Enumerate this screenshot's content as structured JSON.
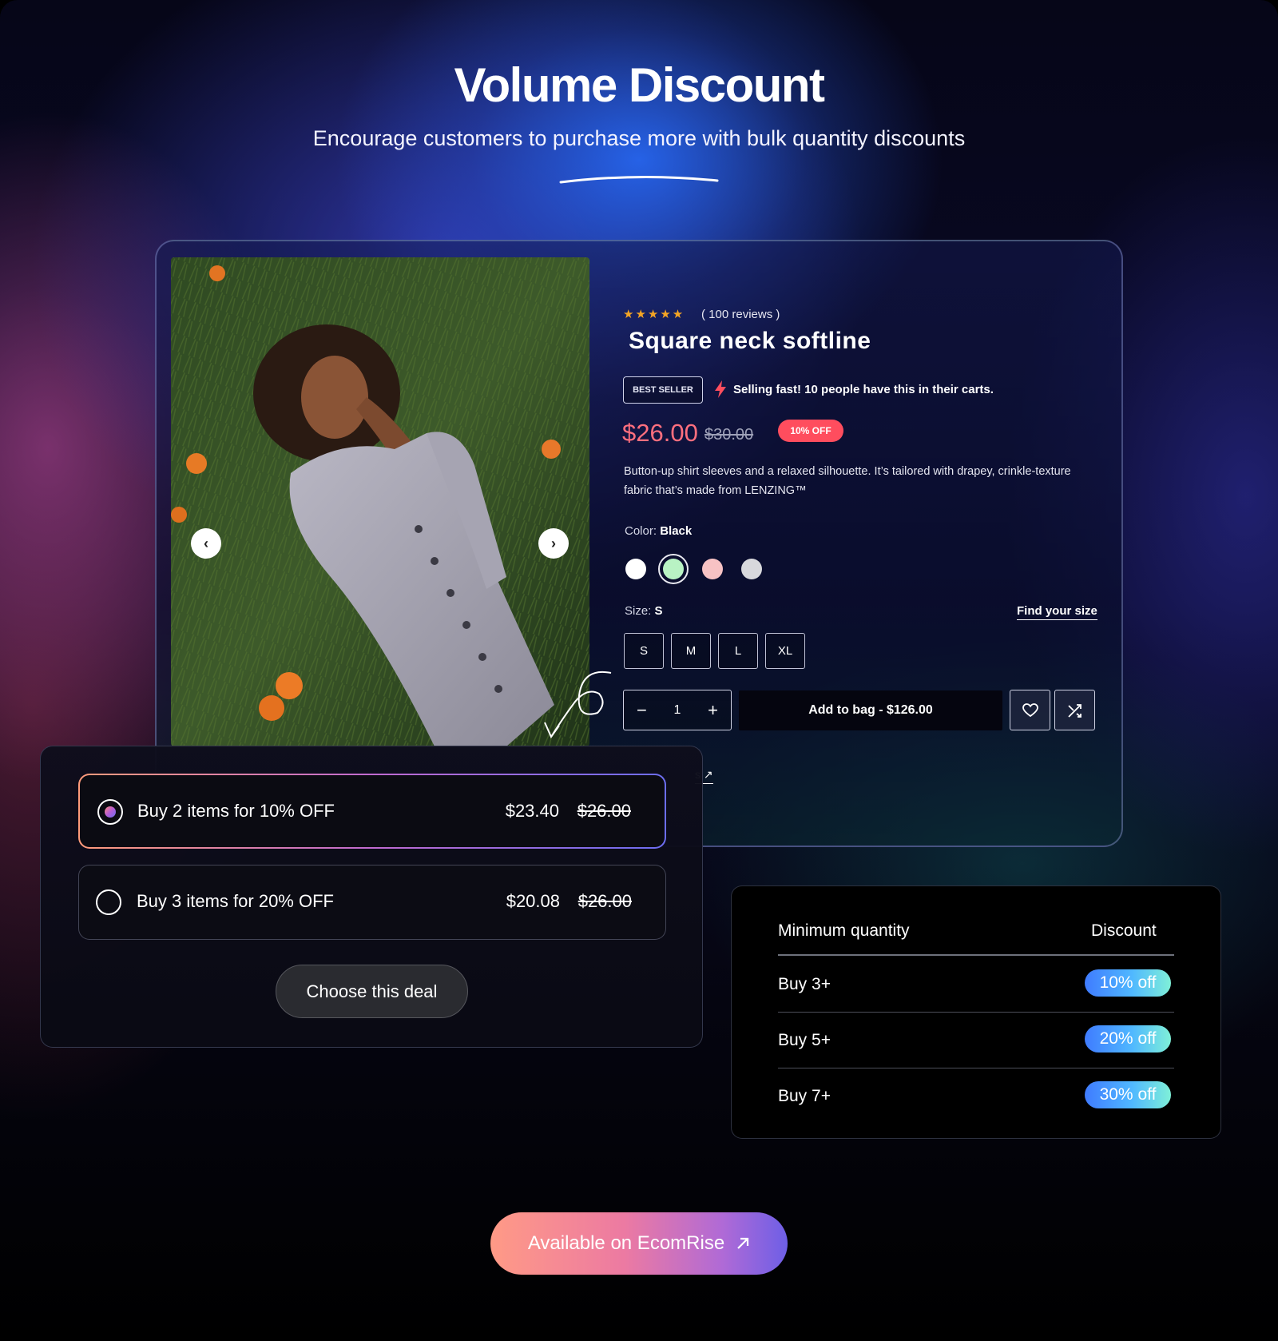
{
  "hero": {
    "title": "Volume Discount",
    "subtitle": "Encourage customers to purchase more with bulk quantity discounts"
  },
  "product": {
    "rating_stars": 5,
    "reviews": "( 100 reviews )",
    "name": "Square neck softline",
    "badge": "BEST SELLER",
    "selling_fast": "Selling fast! 10 people have this in their carts.",
    "price": "$26.00",
    "old_price": "$30.00",
    "discount_badge": "10% OFF",
    "description": "Button-up shirt sleeves and a relaxed silhouette. It’s tailored with drapey, crinkle-texture fabric that’s made from LENZING™",
    "color_label": "Color:",
    "color_value": "Black",
    "swatches": [
      "#ffffff",
      "#b9f3c4",
      "#f7c2c4",
      "#d8d8dc"
    ],
    "size_label": "Size:",
    "size_value": "S",
    "find_size": "Find your size",
    "sizes": [
      "S",
      "M",
      "L",
      "XL"
    ],
    "quantity": "1",
    "qty_minus": "−",
    "qty_plus": "+",
    "add_to_bag": "Add to bag - $126.00",
    "partial_link": "s",
    "prev": "‹",
    "next": "›"
  },
  "deals": {
    "options": [
      {
        "label": "Buy 2 items for 10% OFF",
        "price": "$23.40",
        "old_price": "$26.00",
        "selected": true
      },
      {
        "label": "Buy 3 items for 20% OFF",
        "price": "$20.08",
        "old_price": "$26.00",
        "selected": false
      }
    ],
    "button": "Choose this deal"
  },
  "discount_table": {
    "headers": [
      "Minimum quantity",
      "Discount"
    ],
    "rows": [
      {
        "qty": "Buy 3+",
        "discount": "10% off"
      },
      {
        "qty": "Buy 5+",
        "discount": "20% off"
      },
      {
        "qty": "Buy 7+",
        "discount": "30% off"
      }
    ]
  },
  "cta": {
    "label": "Available on EcomRise",
    "icon": "arrow-up-right-icon"
  },
  "colors": {
    "price": "#ff6f7e",
    "discount_badge": "#ff4d5e",
    "star": "#f5a524",
    "cta_gradient": [
      "#ff9a86",
      "#ec7aa2",
      "#b06ad6",
      "#6e5fe6"
    ],
    "pill_gradient": [
      "#3f7bff",
      "#50b8ff",
      "#7ff0d8"
    ]
  }
}
